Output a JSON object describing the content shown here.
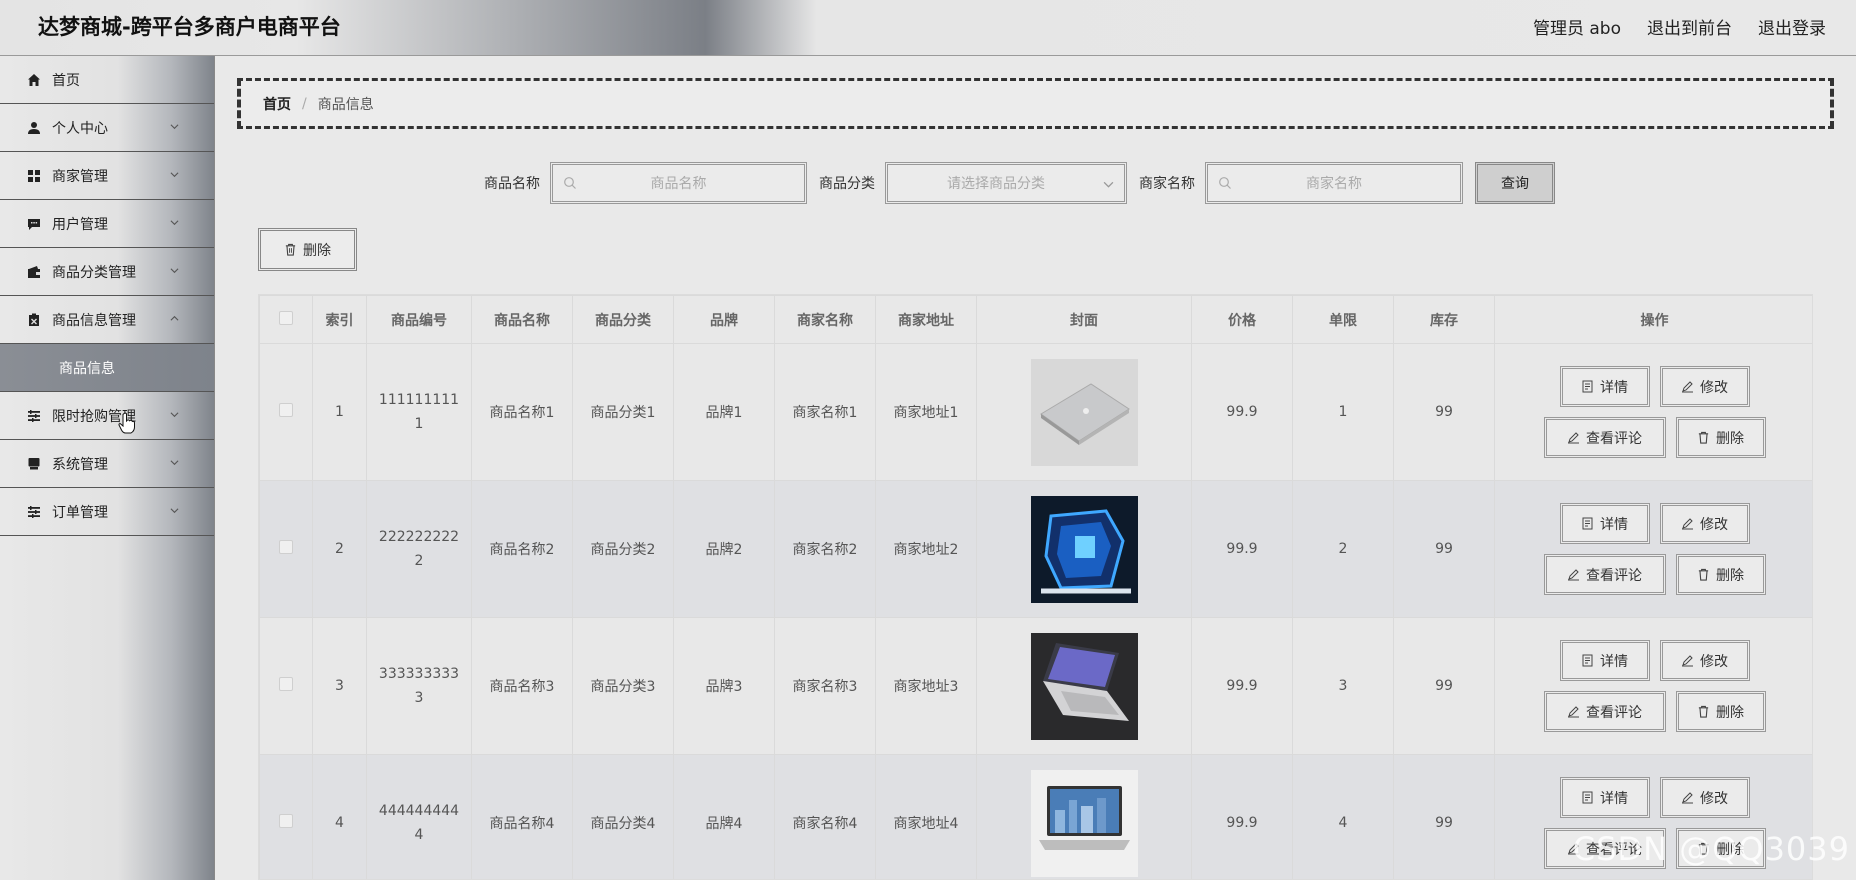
{
  "header": {
    "title": "达梦商城-跨平台多商户电商平台",
    "admin": "管理员 abo",
    "to_front": "退出到前台",
    "logout": "退出登录"
  },
  "sidebar": {
    "items": [
      {
        "label": "首页",
        "icon": "home-icon"
      },
      {
        "label": "个人中心",
        "icon": "user-icon"
      },
      {
        "label": "商家管理",
        "icon": "grid-icon"
      },
      {
        "label": "用户管理",
        "icon": "chat-icon"
      },
      {
        "label": "商品分类管理",
        "icon": "wallet-icon"
      },
      {
        "label": "商品信息管理",
        "icon": "clipboard-x-icon"
      },
      {
        "label": "限时抢购管理",
        "icon": "list-icon"
      },
      {
        "label": "系统管理",
        "icon": "monitor-icon"
      },
      {
        "label": "订单管理",
        "icon": "list-icon"
      }
    ],
    "active_sub": "商品信息"
  },
  "breadcrumb": {
    "home": "首页",
    "sep": "/",
    "current": "商品信息"
  },
  "search": {
    "name_label": "商品名称",
    "name_placeholder": "商品名称",
    "category_label": "商品分类",
    "category_placeholder": "请选择商品分类",
    "merchant_label": "商家名称",
    "merchant_placeholder": "商家名称",
    "query_button": "查询"
  },
  "toolbar": {
    "delete_label": "删除"
  },
  "table": {
    "headers": [
      "索引",
      "商品编号",
      "商品名称",
      "商品分类",
      "品牌",
      "商家名称",
      "商家地址",
      "封面",
      "价格",
      "单限",
      "库存",
      "操作"
    ],
    "actions": {
      "detail": "详情",
      "edit": "修改",
      "comments": "查看评论",
      "delete": "删除"
    },
    "rows": [
      {
        "index": "1",
        "code": "111111111 1",
        "name": "商品名称1",
        "category": "商品分类1",
        "brand": "品牌1",
        "merchant": "商家名称1",
        "address": "商家地址1",
        "cover": "laptop-silver",
        "price": "99.9",
        "limit": "1",
        "stock": "99"
      },
      {
        "index": "2",
        "code": "222222222 2",
        "name": "商品名称2",
        "category": "商品分类2",
        "brand": "品牌2",
        "merchant": "商家名称2",
        "address": "商家地址2",
        "cover": "gaming-pc",
        "price": "99.9",
        "limit": "2",
        "stock": "99"
      },
      {
        "index": "3",
        "code": "333333333 3",
        "name": "商品名称3",
        "category": "商品分类3",
        "brand": "品牌3",
        "merchant": "商家名称3",
        "address": "商家地址3",
        "cover": "laptop-dark",
        "price": "99.9",
        "limit": "3",
        "stock": "99"
      },
      {
        "index": "4",
        "code": "444444444 4",
        "name": "商品名称4",
        "category": "商品分类4",
        "brand": "品牌4",
        "merchant": "商家名称4",
        "address": "商家地址4",
        "cover": "laptop-open",
        "price": "99.9",
        "limit": "4",
        "stock": "99"
      }
    ]
  },
  "watermark": "CSDN @QQ3039"
}
